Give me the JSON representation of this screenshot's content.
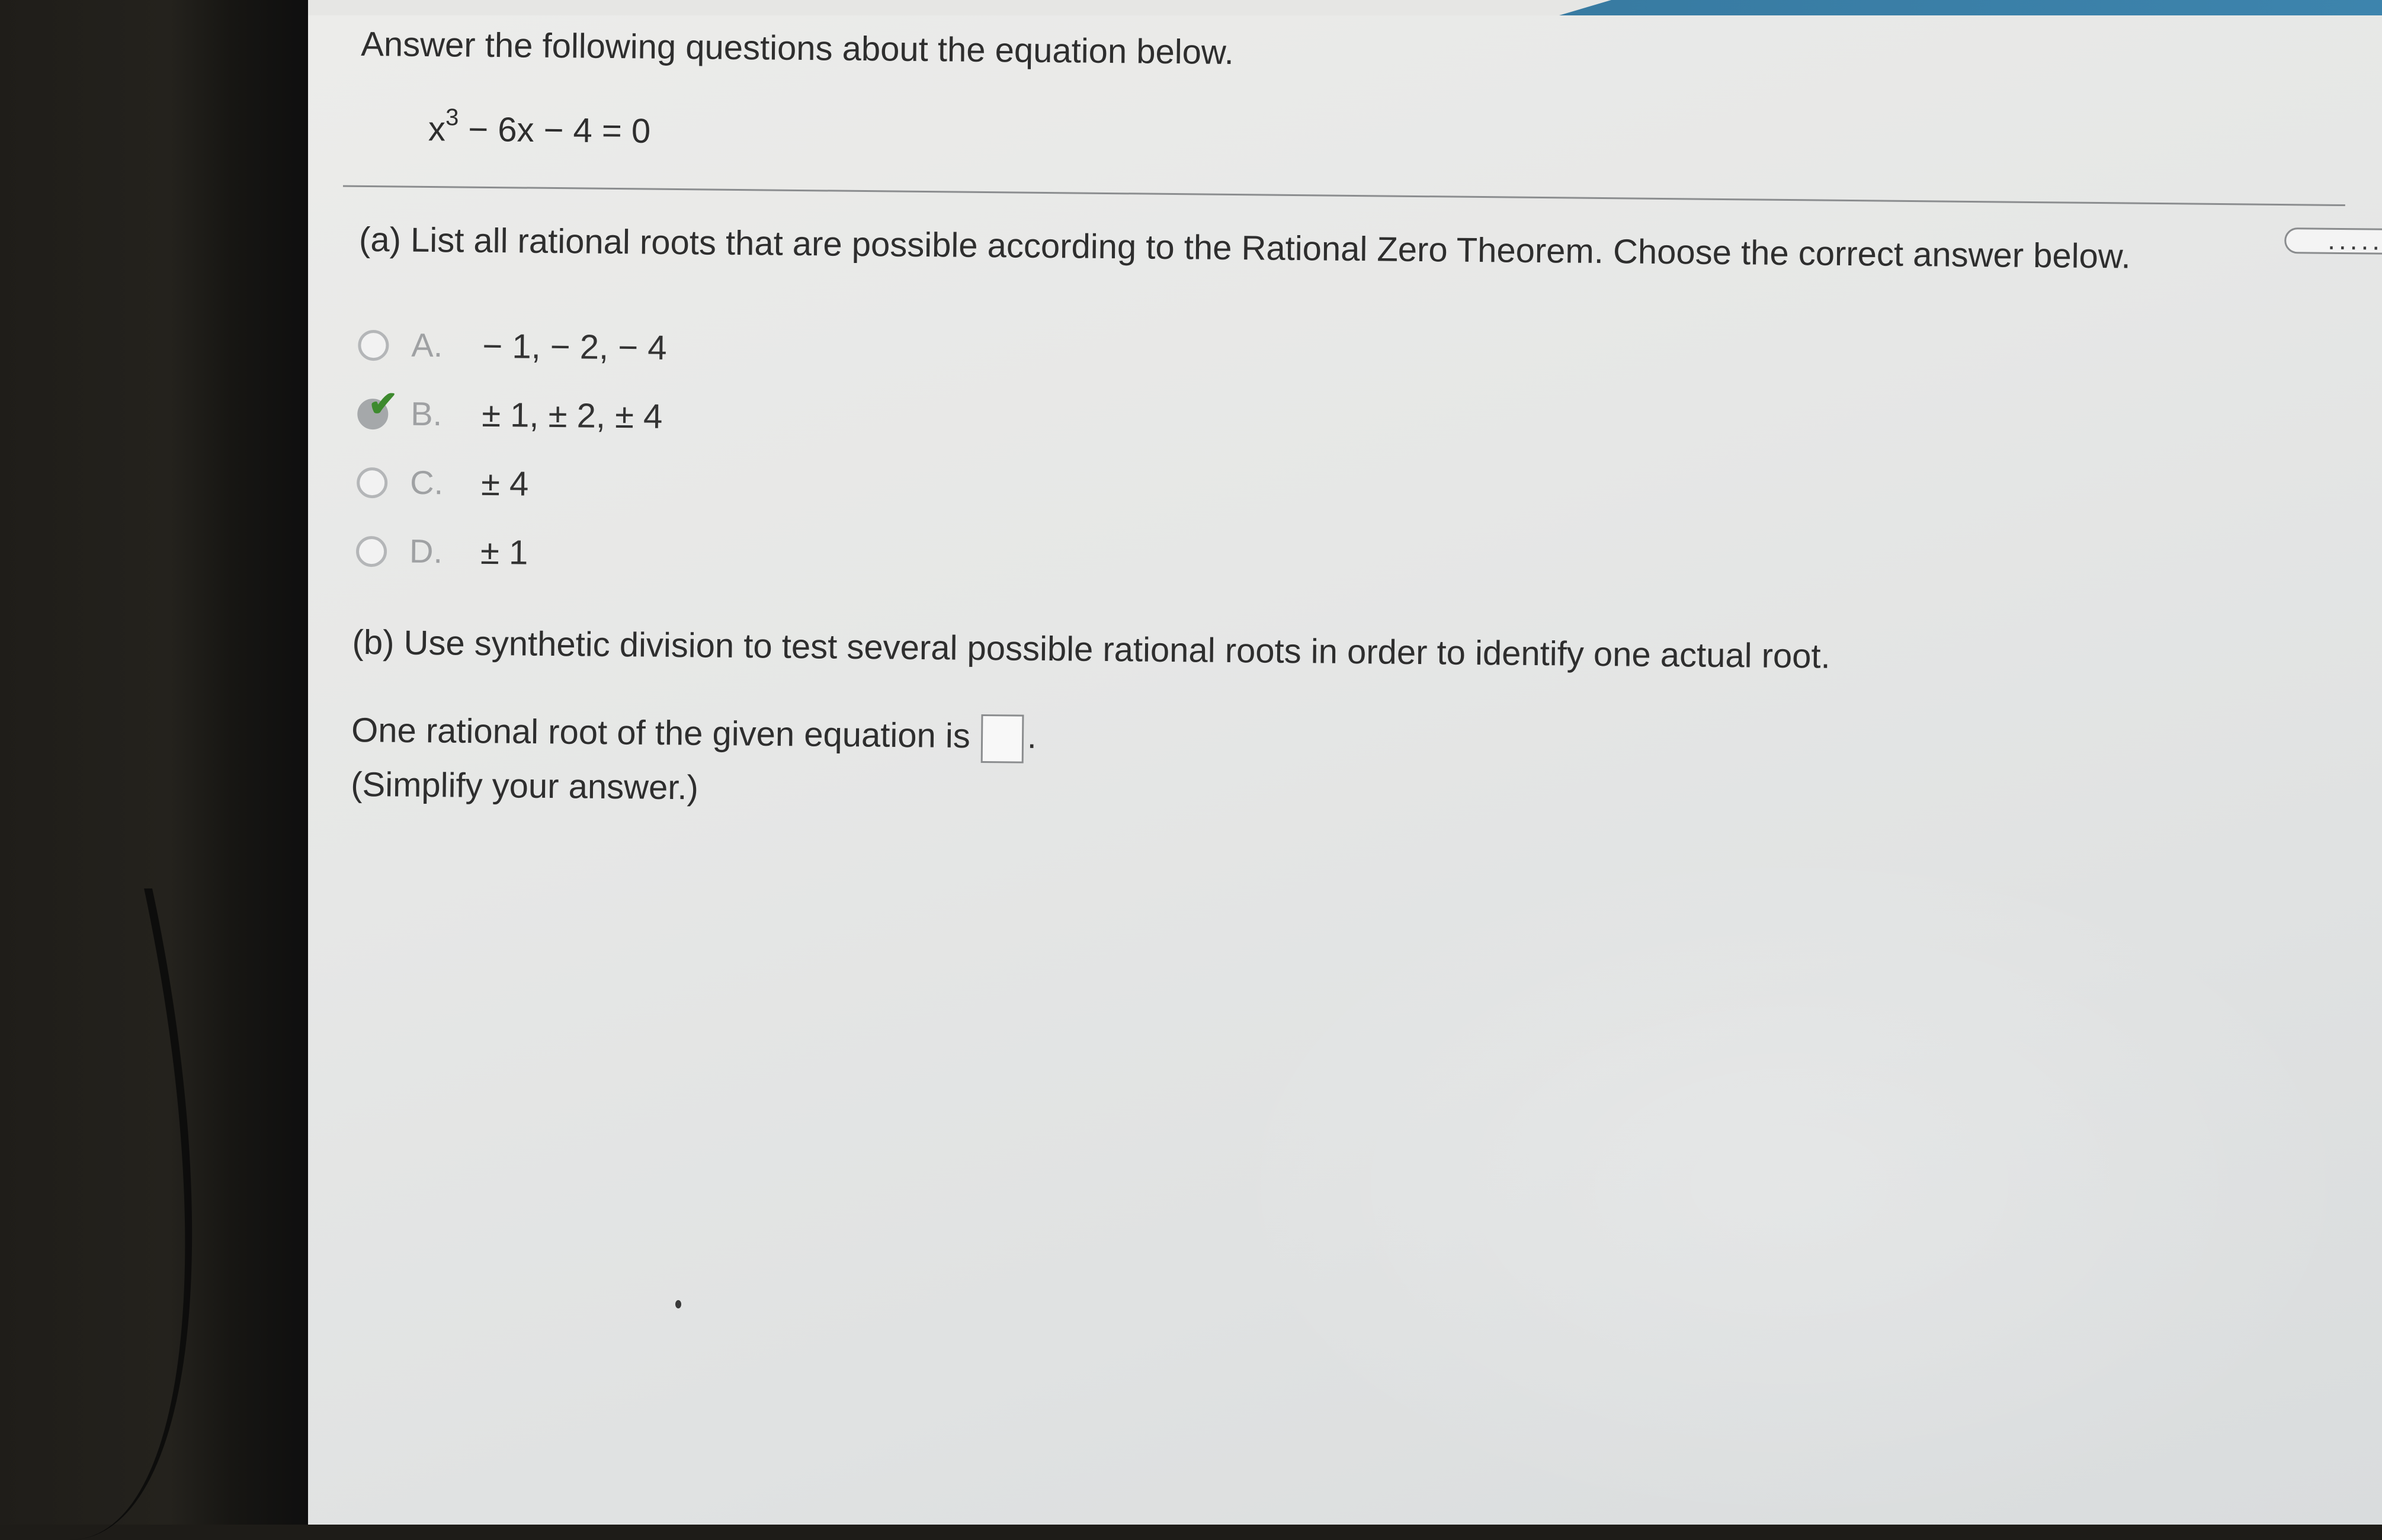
{
  "question": {
    "prompt": "Answer the following questions about the equation below.",
    "equation": {
      "base": "x",
      "exponent": "3",
      "rest": " − 6x − 4 = 0"
    }
  },
  "toolbar": {
    "more_label": "....."
  },
  "part_a": {
    "prompt": "(a) List all rational roots that are possible according to the Rational Zero Theorem. Choose the correct answer below.",
    "selected_choice": "B",
    "choices": [
      {
        "letter": "A.",
        "text": "− 1, − 2, − 4"
      },
      {
        "letter": "B.",
        "text": "± 1, ± 2, ± 4"
      },
      {
        "letter": "C.",
        "text": "± 4"
      },
      {
        "letter": "D.",
        "text": "± 1"
      }
    ],
    "check_icon": "checkmark-icon",
    "check_color": "#3d8a2e"
  },
  "part_b": {
    "prompt": "(b) Use synthetic division to test several possible rational roots in order to identify one actual root.",
    "answer_label": "One rational root of the given equation is",
    "answer_value": "",
    "answer_suffix": ".",
    "hint": "(Simplify your answer.)"
  },
  "colors": {
    "accent": "#3d84ad",
    "text": "#2e2e2e"
  }
}
